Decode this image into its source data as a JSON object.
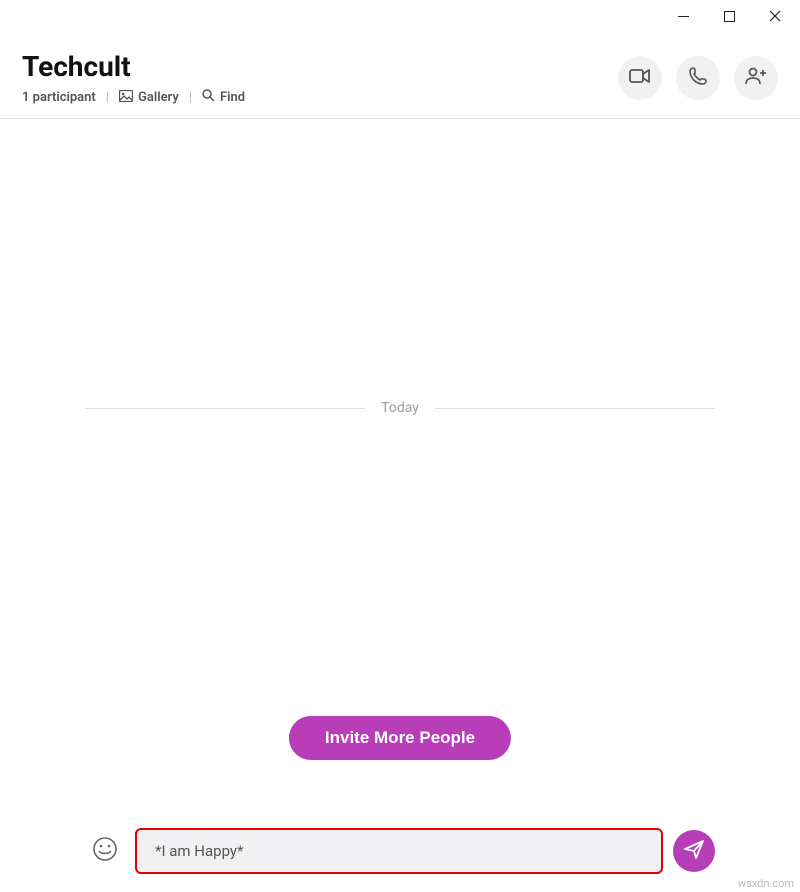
{
  "chat": {
    "title": "Techcult",
    "participants_label": "1 participant",
    "gallery_label": "Gallery",
    "find_label": "Find"
  },
  "divider": {
    "label": "Today"
  },
  "invite": {
    "label": "Invite More People"
  },
  "composer": {
    "value": "*I am Happy*"
  },
  "watermark": "wsxdn.com"
}
